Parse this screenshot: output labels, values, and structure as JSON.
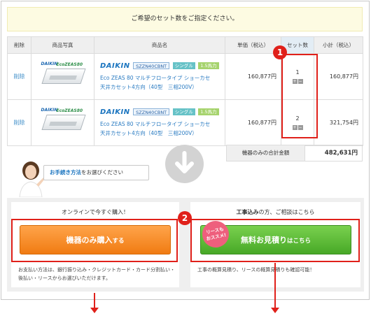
{
  "banner": "ご希望のセット数をご指定ください。",
  "table": {
    "headers": [
      "削除",
      "商品写真",
      "商品名",
      "単価（税込）",
      "セット数",
      "小計（税込）"
    ],
    "rows": [
      {
        "delete_label": "削除",
        "brand": "DAIKIN",
        "model": "SZZN40CBNT",
        "type": "シングル",
        "hp": "1.5馬力",
        "desc_line1": "Eco ZEAS 80 マルチフロータイプ ショーカセ",
        "desc_line2": "天井カセット4方向（40型　三相200V）",
        "price": "160,877円",
        "qty": "1",
        "subtotal": "160,877円"
      },
      {
        "delete_label": "削除",
        "brand": "DAIKIN",
        "model": "SZZN40CBNT",
        "type": "シングル",
        "hp": "1.5馬力",
        "desc_line1": "Eco ZEAS 80 マルチフロータイプ ショーカセ",
        "desc_line2": "天井カセット4方向（40型　三相200V）",
        "price": "160,877円",
        "qty": "2",
        "subtotal": "321,754円"
      }
    ],
    "stepper_plus": "+",
    "stepper_minus": "−",
    "product_image_brand": "DAIKIN",
    "product_image_series": "EcoZEAS80"
  },
  "total": {
    "label": "機器のみの合計金額",
    "value": "482,631円"
  },
  "guide": {
    "highlight": "お手続き方法",
    "rest": "をお選びください"
  },
  "callouts": {
    "one": "1",
    "two": "2"
  },
  "left_panel": {
    "heading": "オンラインで今すぐ購入！",
    "button_main": "機器のみ購入",
    "button_sub": "する",
    "note": "お支払い方法は、銀行振り込み・クレジットカード・カード分割払い・後払い・リースからお選びいただけます。"
  },
  "right_panel": {
    "heading_bold": "工事込み",
    "heading_rest": "の方、ご相談はこちら",
    "button_main": "無料お見積り",
    "button_sub": "はこちら",
    "lease_badge_line1": "リースも",
    "lease_badge_line2": "おススメ!",
    "note": "工事の概算見積り、リースの概算見積りも確認可能！"
  },
  "colors": {
    "accent_red": "#e0201a",
    "orange": "#f07b12",
    "green": "#47a827",
    "link_blue": "#1a74bf"
  }
}
